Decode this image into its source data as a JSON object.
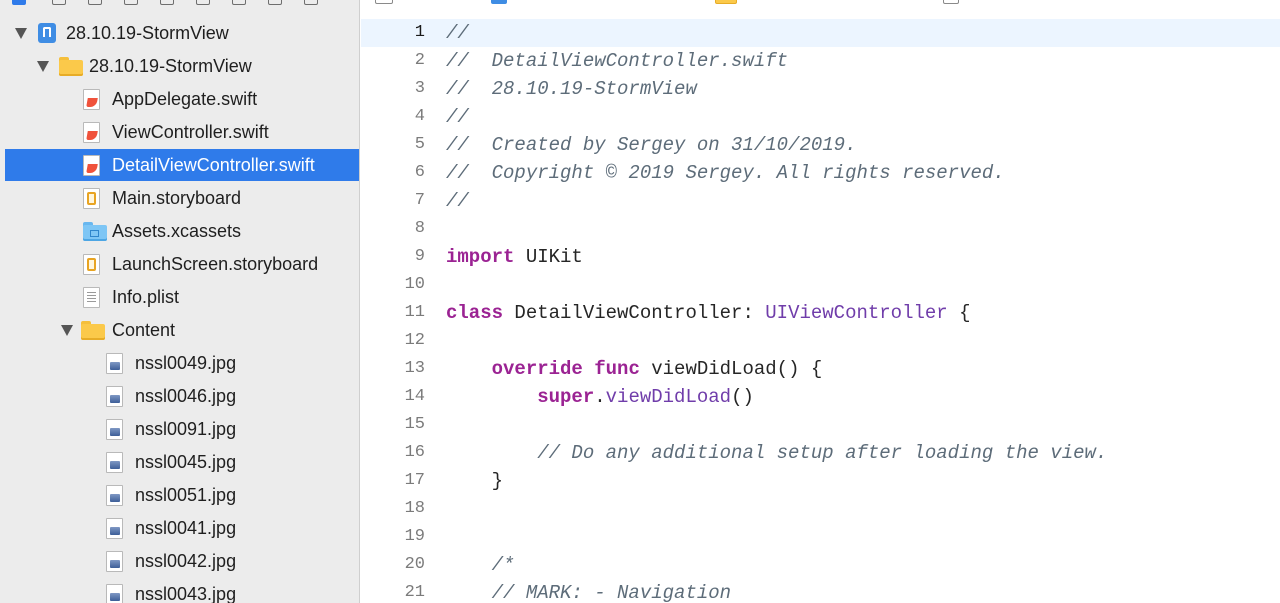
{
  "navigator": {
    "items": [
      {
        "label": "28.10.19-StormView",
        "kind": "project",
        "expanded": true,
        "selected": false
      },
      {
        "label": "28.10.19-StormView",
        "kind": "folder",
        "expanded": true,
        "selected": false
      },
      {
        "label": "AppDelegate.swift",
        "kind": "swift",
        "selected": false
      },
      {
        "label": "ViewController.swift",
        "kind": "swift",
        "selected": false
      },
      {
        "label": "DetailViewController.swift",
        "kind": "swift",
        "selected": true
      },
      {
        "label": "Main.storyboard",
        "kind": "storyboard",
        "selected": false
      },
      {
        "label": "Assets.xcassets",
        "kind": "assets",
        "selected": false
      },
      {
        "label": "LaunchScreen.storyboard",
        "kind": "storyboard",
        "selected": false
      },
      {
        "label": "Info.plist",
        "kind": "plist",
        "selected": false
      },
      {
        "label": "Content",
        "kind": "folder",
        "expanded": true,
        "selected": false
      },
      {
        "label": "nssl0049.jpg",
        "kind": "image",
        "selected": false
      },
      {
        "label": "nssl0046.jpg",
        "kind": "image",
        "selected": false
      },
      {
        "label": "nssl0091.jpg",
        "kind": "image",
        "selected": false
      },
      {
        "label": "nssl0045.jpg",
        "kind": "image",
        "selected": false
      },
      {
        "label": "nssl0051.jpg",
        "kind": "image",
        "selected": false
      },
      {
        "label": "nssl0041.jpg",
        "kind": "image",
        "selected": false
      },
      {
        "label": "nssl0042.jpg",
        "kind": "image",
        "selected": false
      },
      {
        "label": "nssl0043.jpg",
        "kind": "image",
        "selected": false
      }
    ],
    "selection_color": "#2f7bea"
  },
  "editor": {
    "current_line": 1,
    "lines": [
      {
        "n": "1",
        "tokens": [
          {
            "t": "//",
            "c": "comment"
          }
        ]
      },
      {
        "n": "2",
        "tokens": [
          {
            "t": "//  DetailViewController.swift",
            "c": "comment"
          }
        ]
      },
      {
        "n": "3",
        "tokens": [
          {
            "t": "//  28.10.19-StormView",
            "c": "comment"
          }
        ]
      },
      {
        "n": "4",
        "tokens": [
          {
            "t": "//",
            "c": "comment"
          }
        ]
      },
      {
        "n": "5",
        "tokens": [
          {
            "t": "//  Created by Sergey on 31/10/2019.",
            "c": "comment"
          }
        ]
      },
      {
        "n": "6",
        "tokens": [
          {
            "t": "//  Copyright © 2019 Sergey. All rights reserved.",
            "c": "comment"
          }
        ]
      },
      {
        "n": "7",
        "tokens": [
          {
            "t": "//",
            "c": "comment"
          }
        ]
      },
      {
        "n": "8",
        "tokens": []
      },
      {
        "n": "9",
        "tokens": [
          {
            "t": "import",
            "c": "kw"
          },
          {
            "t": " UIKit",
            "c": "plain"
          }
        ]
      },
      {
        "n": "10",
        "tokens": []
      },
      {
        "n": "11",
        "tokens": [
          {
            "t": "class",
            "c": "kw"
          },
          {
            "t": " DetailViewController: ",
            "c": "plain"
          },
          {
            "t": "UIViewController",
            "c": "type"
          },
          {
            "t": " {",
            "c": "plain"
          }
        ]
      },
      {
        "n": "12",
        "tokens": []
      },
      {
        "n": "13",
        "tokens": [
          {
            "t": "    ",
            "c": "plain"
          },
          {
            "t": "override",
            "c": "kw"
          },
          {
            "t": " ",
            "c": "plain"
          },
          {
            "t": "func",
            "c": "kw"
          },
          {
            "t": " viewDidLoad() {",
            "c": "plain"
          }
        ]
      },
      {
        "n": "14",
        "tokens": [
          {
            "t": "        ",
            "c": "plain"
          },
          {
            "t": "super",
            "c": "kw"
          },
          {
            "t": ".",
            "c": "plain"
          },
          {
            "t": "viewDidLoad",
            "c": "type"
          },
          {
            "t": "()",
            "c": "plain"
          }
        ]
      },
      {
        "n": "15",
        "tokens": []
      },
      {
        "n": "16",
        "tokens": [
          {
            "t": "        ",
            "c": "plain"
          },
          {
            "t": "// Do any additional setup after loading the view.",
            "c": "comment"
          }
        ]
      },
      {
        "n": "17",
        "tokens": [
          {
            "t": "    }",
            "c": "plain"
          }
        ]
      },
      {
        "n": "18",
        "tokens": []
      },
      {
        "n": "19",
        "tokens": []
      },
      {
        "n": "20",
        "tokens": [
          {
            "t": "    ",
            "c": "plain"
          },
          {
            "t": "/*",
            "c": "comment"
          }
        ]
      },
      {
        "n": "21",
        "tokens": [
          {
            "t": "    ",
            "c": "plain"
          },
          {
            "t": "// MARK: - Navigation",
            "c": "comment"
          }
        ]
      }
    ],
    "current_line_color": "#ecf5ff"
  }
}
